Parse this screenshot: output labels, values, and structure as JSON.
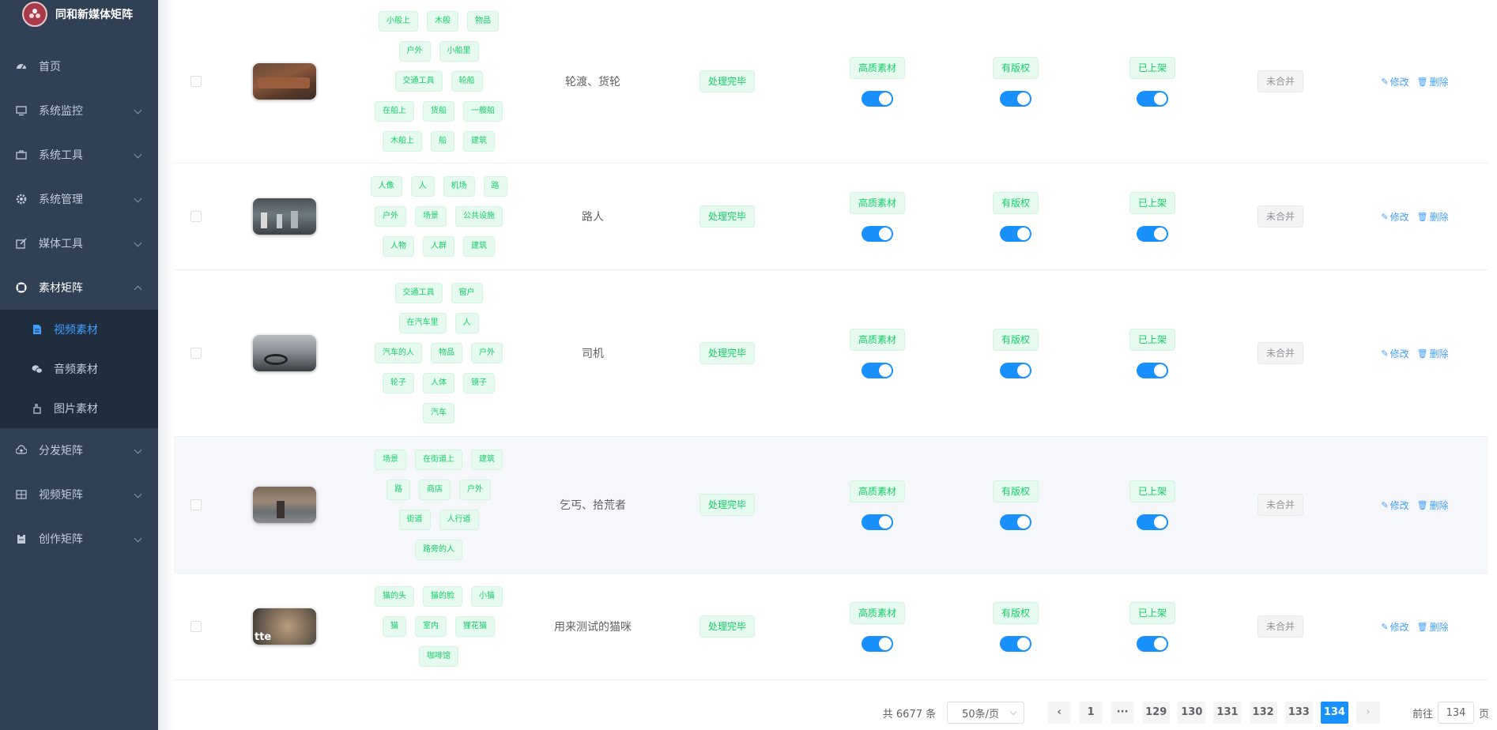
{
  "app": {
    "title": "同和新媒体矩阵"
  },
  "sidebar": {
    "items": [
      {
        "label": "首页",
        "icon": "dashboard-icon"
      },
      {
        "label": "系统监控",
        "icon": "monitor-icon"
      },
      {
        "label": "系统工具",
        "icon": "toolbox-icon"
      },
      {
        "label": "系统管理",
        "icon": "gear-icon"
      },
      {
        "label": "媒体工具",
        "icon": "edit-icon"
      },
      {
        "label": "素材矩阵",
        "icon": "lifebuoy-icon"
      },
      {
        "label": "分发矩阵",
        "icon": "cloud-upload-icon"
      },
      {
        "label": "视频矩阵",
        "icon": "grid-icon"
      },
      {
        "label": "创作矩阵",
        "icon": "clipboard-icon"
      }
    ],
    "sub_items": [
      {
        "label": "视频素材",
        "icon": "document-icon"
      },
      {
        "label": "音频素材",
        "icon": "chat-icon"
      },
      {
        "label": "图片素材",
        "icon": "hand-icon"
      }
    ]
  },
  "table": {
    "rows": [
      {
        "tags": [
          [
            "小般上",
            "木般",
            "物品"
          ],
          [
            "户外",
            "小船里"
          ],
          [
            "交通工具",
            "轮船"
          ],
          [
            "在船上",
            "货船",
            "一艘船"
          ],
          [
            "木船上",
            "船",
            "建筑"
          ]
        ],
        "name": "轮渡、货轮",
        "status": "处理完毕",
        "quality": "高质素材",
        "copyright": "有版权",
        "shelf": "已上架",
        "merge": "未合并",
        "edit": "修改",
        "delete": "删除"
      },
      {
        "tags": [
          [
            "人像",
            "人",
            "机场",
            "路"
          ],
          [
            "户外",
            "场景",
            "公共设施"
          ],
          [
            "人物",
            "人群",
            "建筑"
          ]
        ],
        "name": "路人",
        "status": "处理完毕",
        "quality": "高质素材",
        "copyright": "有版权",
        "shelf": "已上架",
        "merge": "未合并",
        "edit": "修改",
        "delete": "删除"
      },
      {
        "tags": [
          [
            "交通工具",
            "窗户"
          ],
          [
            "在汽车里",
            "人"
          ],
          [
            "汽车的人",
            "物品",
            "户外"
          ],
          [
            "轮子",
            "人体",
            "镜子"
          ],
          [
            "汽车"
          ]
        ],
        "name": "司机",
        "status": "处理完毕",
        "quality": "高质素材",
        "copyright": "有版权",
        "shelf": "已上架",
        "merge": "未合并",
        "edit": "修改",
        "delete": "删除"
      },
      {
        "tags": [
          [
            "场景",
            "在街道上",
            "建筑"
          ],
          [
            "路",
            "商店",
            "户外"
          ],
          [
            "街道",
            "人行道"
          ],
          [
            "路旁的人"
          ]
        ],
        "name": "乞丐、拾荒者",
        "status": "处理完毕",
        "quality": "高质素材",
        "copyright": "有版权",
        "shelf": "已上架",
        "merge": "未合并",
        "edit": "修改",
        "delete": "删除"
      },
      {
        "tags": [
          [
            "猫的头",
            "猫的脸",
            "小猫"
          ],
          [
            "猫",
            "室内",
            "狸花猫"
          ],
          [
            "咖啡馆"
          ]
        ],
        "name": "用来测试的猫咪",
        "status": "处理完毕",
        "quality": "高质素材",
        "copyright": "有版权",
        "shelf": "已上架",
        "merge": "未合并",
        "edit": "修改",
        "delete": "删除"
      }
    ]
  },
  "pagination": {
    "total": "共 6677 条",
    "page_size": "50条/页",
    "pages": [
      "1",
      "···",
      "129",
      "130",
      "131",
      "132",
      "133",
      "134"
    ],
    "current": "134",
    "goto_label": "前往",
    "goto_value": "134",
    "goto_suffix": "页"
  },
  "colors": {
    "sidebar_bg": "#304156",
    "submenu_bg": "#1f2d3d",
    "accent": "#1890ff",
    "tag_green": "#13ce66"
  }
}
